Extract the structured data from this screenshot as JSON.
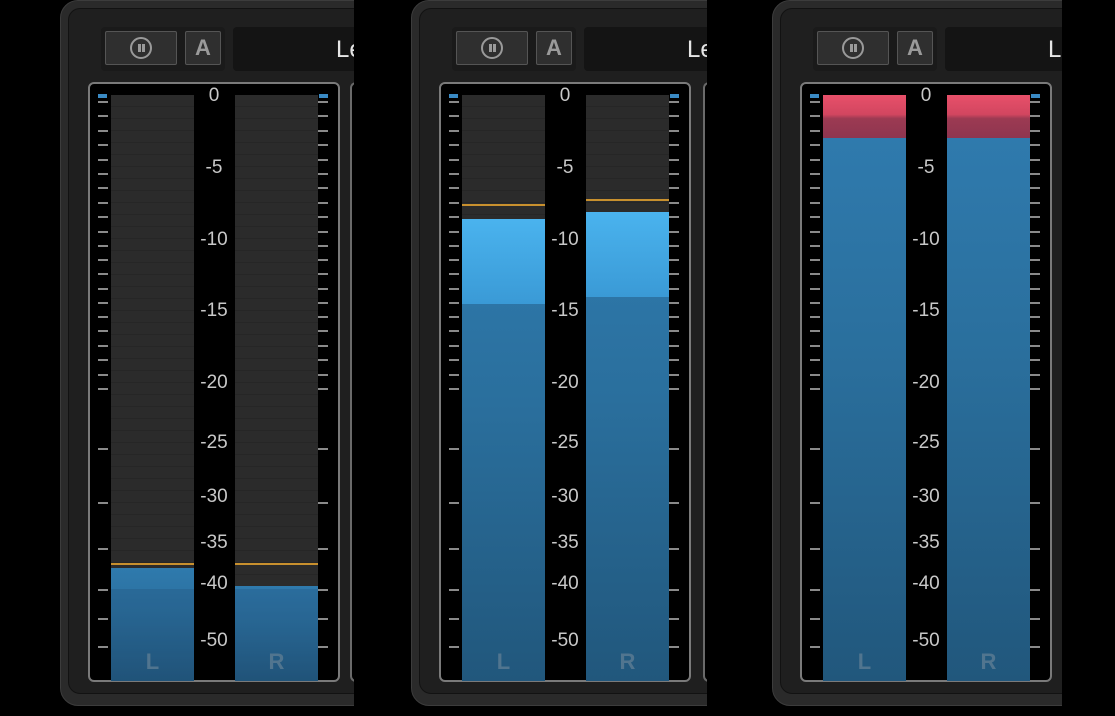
{
  "meters": [
    {
      "label_text": "Le",
      "pause_icon": "pause-icon",
      "auto_label": "A",
      "channels": [
        {
          "name": "L",
          "peak_db": -38.2,
          "rms_db": -41,
          "hold_db": -37.6,
          "red_to_db": null
        },
        {
          "name": "R",
          "peak_db": -40.6,
          "rms_db": -41,
          "hold_db": -37.6,
          "red_to_db": null
        }
      ],
      "scale": [
        "0",
        "-5",
        "-10",
        "-15",
        "-20",
        "-25",
        "-30",
        "-35",
        "-40",
        "-50"
      ]
    },
    {
      "label_text": "Le",
      "pause_icon": "pause-icon",
      "auto_label": "A",
      "channels": [
        {
          "name": "L",
          "peak_db": -8.6,
          "rms_db": -14.6,
          "hold_db": -7.6,
          "red_to_db": null
        },
        {
          "name": "R",
          "peak_db": -8.1,
          "rms_db": -14.1,
          "hold_db": -7.2,
          "red_to_db": null
        }
      ],
      "scale": [
        "0",
        "-5",
        "-10",
        "-15",
        "-20",
        "-25",
        "-30",
        "-35",
        "-40",
        "-50"
      ]
    },
    {
      "label_text": "Le",
      "pause_icon": "pause-icon",
      "auto_label": "A",
      "channels": [
        {
          "name": "L",
          "peak_db": -3.0,
          "rms_db": null,
          "hold_db": null,
          "red_to_db": -3.0
        },
        {
          "name": "R",
          "peak_db": -3.0,
          "rms_db": null,
          "hold_db": null,
          "red_to_db": -3.0
        }
      ],
      "scale": [
        "0",
        "-5",
        "-10",
        "-15",
        "-20",
        "-25",
        "-30",
        "-35",
        "-40",
        "-50"
      ]
    }
  ],
  "colors": {
    "peak": "#2f7aad",
    "peak_bright": "#4ab3ee",
    "clip": "#e8506a",
    "hold": "#c8902e"
  }
}
